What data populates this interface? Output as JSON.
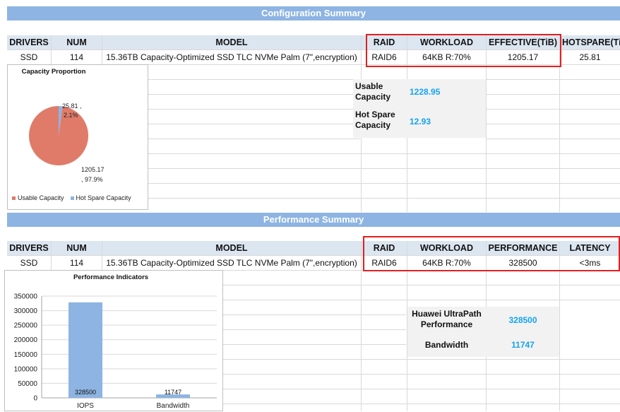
{
  "config": {
    "banner": "Configuration Summary",
    "headers": {
      "drivers": "DRIVERS",
      "num": "NUM",
      "model": "MODEL",
      "raid": "RAID",
      "workload": "WORKLOAD",
      "effective": "EFFECTIVE(TiB)",
      "hotspare": "HOTSPARE(TiB"
    },
    "row": {
      "drivers": "SSD",
      "num": "114",
      "model": "15.36TB Capacity-Optimized SSD TLC NVMe Palm (7\",encryption)",
      "raid": "RAID6",
      "workload": "64KB R:70%",
      "effective": "1205.17",
      "hotspare": "25.81"
    },
    "usable_label_1": "Usable",
    "usable_label_2": "Capacity",
    "usable_value": "1228.95",
    "hotspare_label_1": "Hot Spare",
    "hotspare_label_2": "Capacity",
    "hotspare_value": "12.93",
    "pie": {
      "title": "Capacity Proportion",
      "label_small_1": "25.81 ,",
      "label_small_2": "2.1%",
      "label_big_1": "1205.17",
      "label_big_2": ", 97.9%",
      "legend_usable": "Usable Capacity",
      "legend_hotspare": "Hot Spare Capacity",
      "colors": {
        "usable": "#e07b69",
        "hotspare": "#8db4e2"
      }
    }
  },
  "perf": {
    "banner": "Performance Summary",
    "headers": {
      "drivers": "DRIVERS",
      "num": "NUM",
      "model": "MODEL",
      "raid": "RAID",
      "workload": "WORKLOAD",
      "performance": "PERFORMANCE",
      "latency": "LATENCY"
    },
    "row": {
      "drivers": "SSD",
      "num": "114",
      "model": "15.36TB Capacity-Optimized SSD TLC NVMe Palm (7\",encryption)",
      "raid": "RAID6",
      "workload": "64KB R:70%",
      "performance": "328500",
      "latency": "<3ms"
    },
    "ultrapath_label_1": "Huawei UltraPath",
    "ultrapath_label_2": "Performance",
    "ultrapath_value": "328500",
    "bandwidth_label": "Bandwidth",
    "bandwidth_value": "11747"
  },
  "chart_data": [
    {
      "type": "pie",
      "title": "Capacity Proportion",
      "labels": [
        "Usable Capacity",
        "Hot Spare Capacity"
      ],
      "values": [
        1205.17,
        25.81
      ],
      "percents": [
        97.9,
        2.1
      ],
      "legend": "bottom"
    },
    {
      "type": "bar",
      "title": "Performance Indicators",
      "categories": [
        "IOPS",
        "Bandwidth"
      ],
      "values": [
        328500,
        11747
      ],
      "ylim": [
        0,
        350000
      ],
      "yticks": [
        "350000",
        "300000",
        "250000",
        "200000",
        "150000",
        "100000",
        "50000",
        "0"
      ],
      "data_labels": [
        "328500",
        "11747"
      ],
      "color": "#8db4e2",
      "grid": true
    }
  ]
}
